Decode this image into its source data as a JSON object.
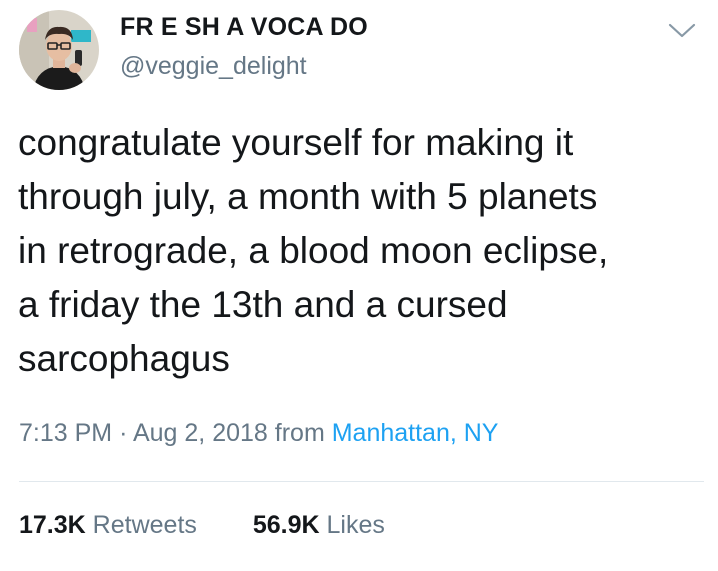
{
  "user": {
    "display_name": "FR E SH A VOCA DO",
    "handle": "@veggie_delight"
  },
  "tweet": {
    "text": "congratulate yourself for making it\nthrough july, a month with 5 planets\nin retrograde, a blood moon eclipse,\na friday the 13th and a cursed\nsarcophagus",
    "time": "7:13 PM",
    "separator": "·",
    "date": "Aug 2, 2018",
    "from_label": "from",
    "location": "Manhattan, NY"
  },
  "stats": {
    "retweets_count": "17.3K",
    "retweets_label": "Retweets",
    "likes_count": "56.9K",
    "likes_label": "Likes"
  },
  "icons": {
    "menu": "chevron-down-icon",
    "avatar": "user-avatar"
  },
  "colors": {
    "text": "#14171a",
    "secondary": "#657786",
    "link": "#1da1f2",
    "divider": "#e1e8ed"
  }
}
